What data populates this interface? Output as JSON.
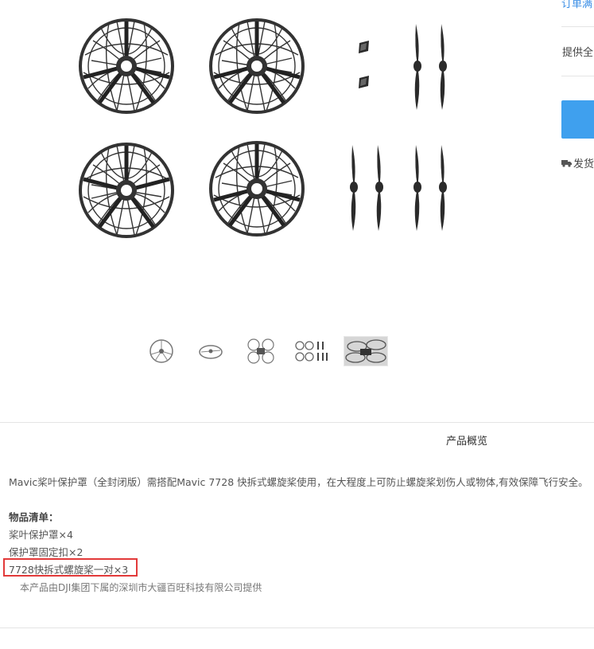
{
  "right_panel": {
    "link_text": "订单满",
    "service_text": "提供全",
    "shipping_text": "发货",
    "truck_icon": "truck-icon",
    "button_color": "#3fa0ee"
  },
  "gallery": {
    "thumbnails": [
      "prop-guard-front",
      "prop-guard-side",
      "drone-with-guards",
      "guards-and-props-set",
      "drone-photo"
    ],
    "active_index": 4
  },
  "tabs": {
    "overview": "产品概览"
  },
  "content": {
    "description": "Mavic桨叶保护罩（全封闭版）需搭配Mavic 7728 快拆式螺旋桨使用，在大程度上可防止螺旋桨划伤人或物体,有效保障飞行安全。",
    "list_title": "物品清单：",
    "items": [
      "桨叶保护罩×4",
      "保护罩固定扣×2",
      "7728快拆式螺旋桨一对×3"
    ],
    "footnote": "本产品由DJI集团下属的深圳市大疆百旺科技有限公司提供"
  },
  "colors": {
    "highlight": "#e23a3a",
    "link": "#3a8ee6"
  }
}
